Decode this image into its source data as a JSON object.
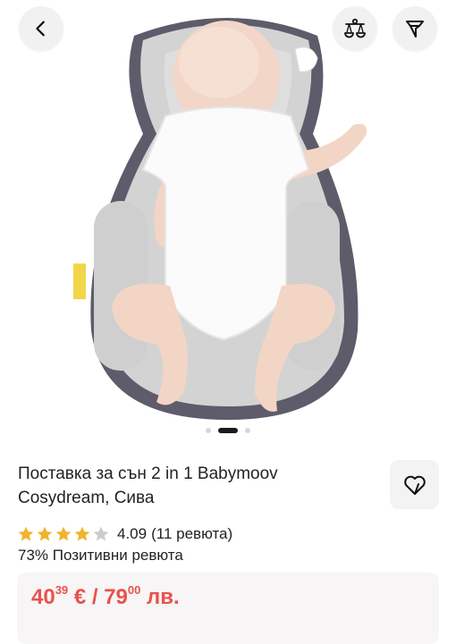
{
  "nav": {
    "back_icon": "chevron-left-icon",
    "compare_icon": "balance-scale-icon",
    "filter_icon": "filter-icon"
  },
  "gallery": {
    "image_alt": "product-image-baby-on-sleep-positioner",
    "brand_tag": "babymoov",
    "dots_total": 3,
    "dots_active": 2
  },
  "product": {
    "title_line1": "Поставка за сън 2 in 1 Babymoov",
    "title_line2": "Cosydream, Сива",
    "favorite_icon": "heart-icon"
  },
  "rating": {
    "score": 4.09,
    "score_text": "4.09",
    "reviews_text": "(11 ревюта)",
    "stars_filled": 4,
    "stars_total": 5,
    "positive_text": "73% Позитивни ревюта"
  },
  "price": {
    "eur_whole": "40",
    "eur_cents": "39",
    "eur_symbol": " € / ",
    "bgn_whole": "79",
    "bgn_cents": "00",
    "bgn_symbol": " лв."
  },
  "colors": {
    "price_red": "#e9524e",
    "star_gold": "#f0b429",
    "star_empty": "#cccccc"
  }
}
